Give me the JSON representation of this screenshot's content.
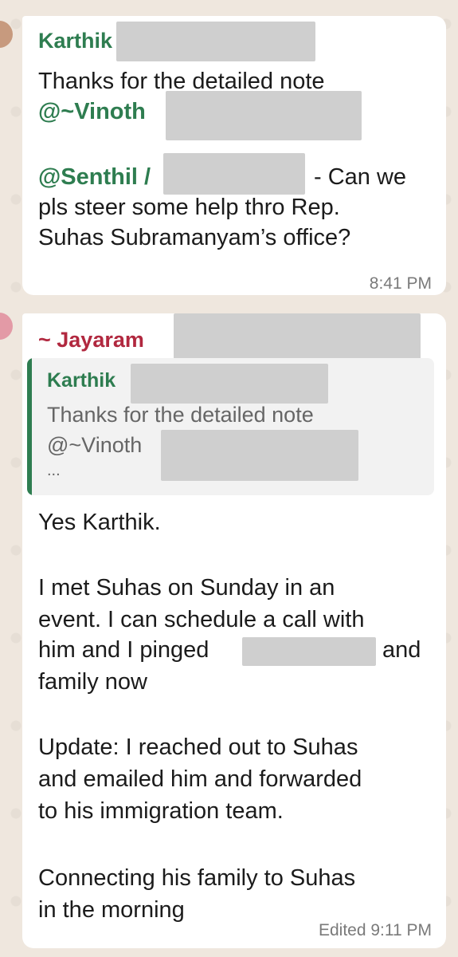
{
  "messages": [
    {
      "sender": "Karthik",
      "line1": "Thanks for the detailed note",
      "mention1": "@~Vinoth",
      "mention2": "@Senthil /",
      "line3_tail": "- Can we",
      "line4": "pls steer some help thro Rep.",
      "line5": "Suhas Subramanyam’s office?",
      "time": "8:41 PM"
    },
    {
      "sender": "~ Jayaram",
      "quote": {
        "sender": "Karthik",
        "line1": "Thanks for the detailed note",
        "line2": "@~Vinoth",
        "ellipsis": "..."
      },
      "p1": "Yes Karthik.",
      "p2_l1": "I met Suhas on Sunday in an",
      "p2_l2": "event. I can schedule a call with",
      "p2_l3a": "him and I pinged",
      "p2_l3b": "and",
      "p2_l4": "family now",
      "p3_l1": "Update: I reached out to Suhas",
      "p3_l2": "and emailed him and forwarded",
      "p3_l3": "to his immigration team.",
      "p4_l1": "Connecting his family to Suhas",
      "p4_l2": "in the morning",
      "time": "Edited 9:11 PM"
    }
  ]
}
